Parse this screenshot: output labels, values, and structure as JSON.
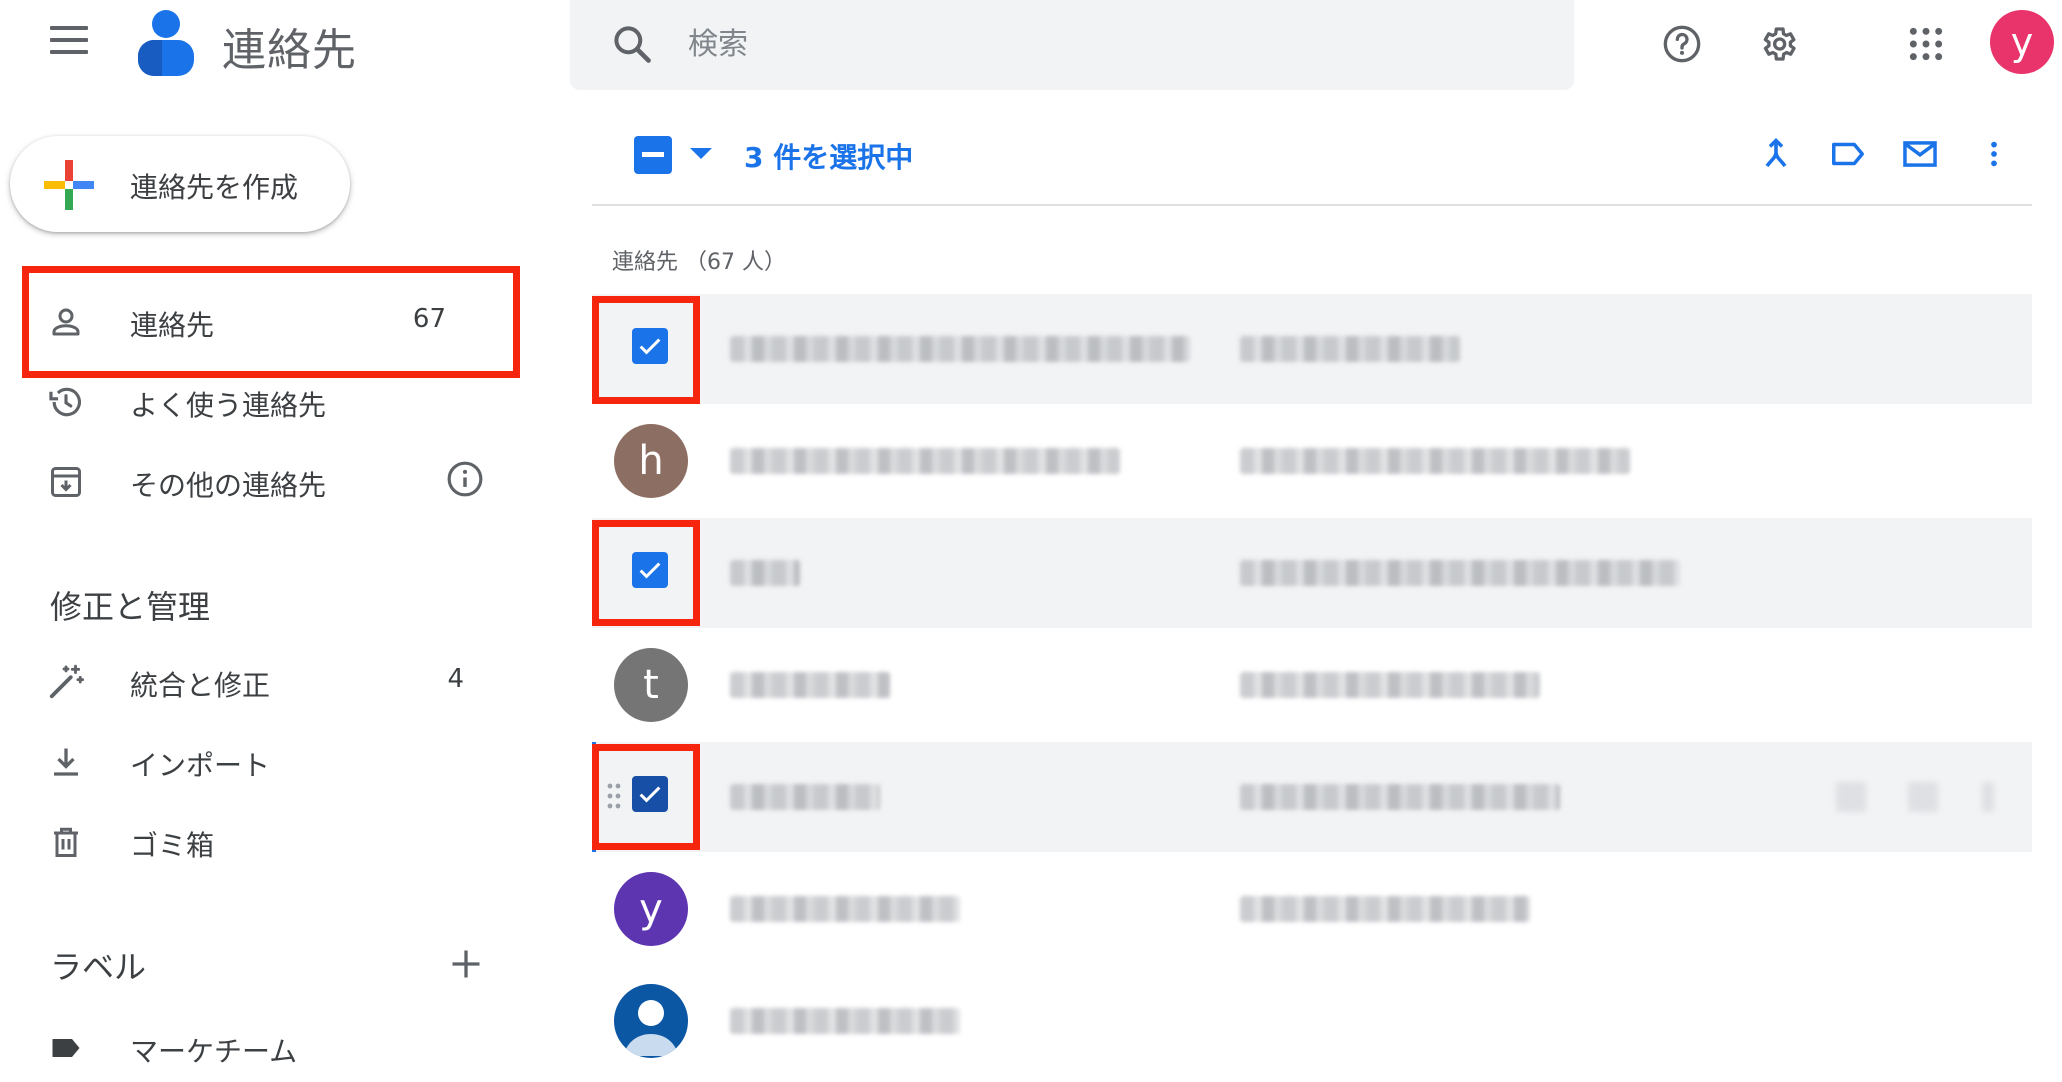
{
  "header": {
    "app_title": "連絡先",
    "search_placeholder": "検索",
    "avatar_letter": "y",
    "icons": [
      "menu-icon",
      "help-icon",
      "settings-icon",
      "apps-grid-icon"
    ]
  },
  "sidebar": {
    "create_label": "連絡先を作成",
    "items": [
      {
        "label": "連絡先",
        "count": "67",
        "icon": "person-icon"
      },
      {
        "label": "よく使う連絡先",
        "icon": "history-icon"
      },
      {
        "label": "その他の連絡先",
        "icon": "archive-icon"
      }
    ],
    "fix_section_title": "修正と管理",
    "fix_items": [
      {
        "label": "統合と修正",
        "count": "4",
        "icon": "magic-wand-icon"
      },
      {
        "label": "インポート",
        "icon": "download-icon"
      },
      {
        "label": "ゴミ箱",
        "icon": "trash-icon"
      }
    ],
    "labels_section_title": "ラベル",
    "labels": [
      {
        "label": "マーケチーム",
        "icon": "label-icon"
      }
    ]
  },
  "toolbar": {
    "selected_text": "3 件を選択中",
    "icons": [
      "merge-icon",
      "label-icon",
      "email-icon",
      "more-vert-icon"
    ]
  },
  "list": {
    "header": "連絡先 （67 人）",
    "rows": [
      {
        "selected": true
      },
      {
        "selected": false,
        "avatar": "h",
        "avatar_color": "#8d6e63"
      },
      {
        "selected": true
      },
      {
        "selected": false,
        "avatar": "t",
        "avatar_color": "#757575"
      },
      {
        "selected": true,
        "focused": true
      },
      {
        "selected": false,
        "avatar": "y",
        "avatar_color": "#5e35b1"
      },
      {
        "selected": false,
        "avatar_photo": true,
        "avatar_color": "#0b57a4"
      }
    ]
  },
  "colors": {
    "accent": "#1a73e8",
    "highlight": "#f5260d",
    "avatar_top": "#e8336b"
  }
}
